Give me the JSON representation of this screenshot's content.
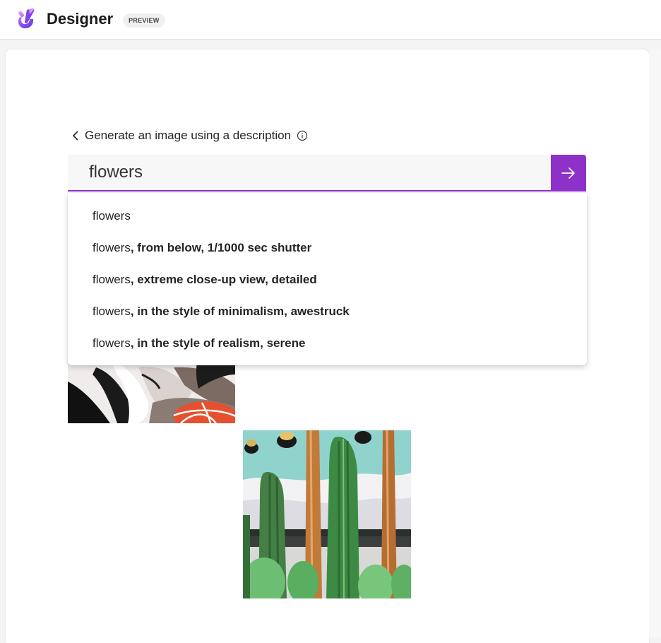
{
  "header": {
    "app_name": "Designer",
    "badge": "PREVIEW",
    "logo_icon": "designer-logo-icon"
  },
  "prompt": {
    "back_label": "Generate an image using a description",
    "back_icon": "chevron-left-icon",
    "info_icon": "info-icon",
    "input_value": "flowers",
    "submit_icon": "arrow-right-icon"
  },
  "suggestions": [
    {
      "base": "flowers",
      "extra": ""
    },
    {
      "base": "flowers",
      "extra": ", from below, 1/1000 sec shutter"
    },
    {
      "base": "flowers",
      "extra": ", extreme close-up view, detailed"
    },
    {
      "base": "flowers",
      "extra": ", in the style of minimalism, awestruck"
    },
    {
      "base": "flowers",
      "extra": ", in the style of realism, serene"
    }
  ],
  "colors": {
    "accent": "#8d31c9",
    "panel_bg": "#ffffff",
    "page_bg": "#f4f4f4"
  }
}
